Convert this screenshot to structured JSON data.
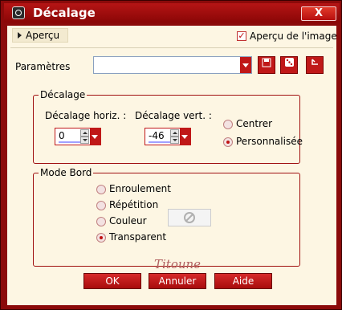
{
  "window": {
    "title": "Décalage",
    "close_label": "X",
    "app_icon": "app-icon"
  },
  "preview": {
    "toggle_label": "Aperçu",
    "checkbox_label": "Aperçu de l'image",
    "checked": true
  },
  "params": {
    "label": "Paramètres",
    "preset_value": ""
  },
  "toolbar": {
    "save_icon": "save-icon",
    "random_icon": "dice-icon",
    "reset_icon": "reset-icon"
  },
  "offset_group": {
    "title": "Décalage",
    "horiz_label": "Décalage horiz. :",
    "horiz_value": "0",
    "vert_label": "Décalage vert. :",
    "vert_value": "-46",
    "radios": [
      {
        "label": "Centrer",
        "selected": false
      },
      {
        "label": "Personnalisée",
        "selected": true
      }
    ]
  },
  "edge_group": {
    "title": "Mode Bord",
    "radios": [
      {
        "label": "Enroulement",
        "selected": false
      },
      {
        "label": "Répétition",
        "selected": false
      },
      {
        "label": "Couleur",
        "selected": false
      },
      {
        "label": "Transparent",
        "selected": true
      }
    ]
  },
  "signature": "Titoune",
  "buttons": {
    "ok": "OK",
    "cancel": "Annuler",
    "help": "Aide"
  },
  "colors": {
    "accent": "#c01818",
    "background": "#fdf6e3",
    "frame": "#8b0a0a"
  }
}
